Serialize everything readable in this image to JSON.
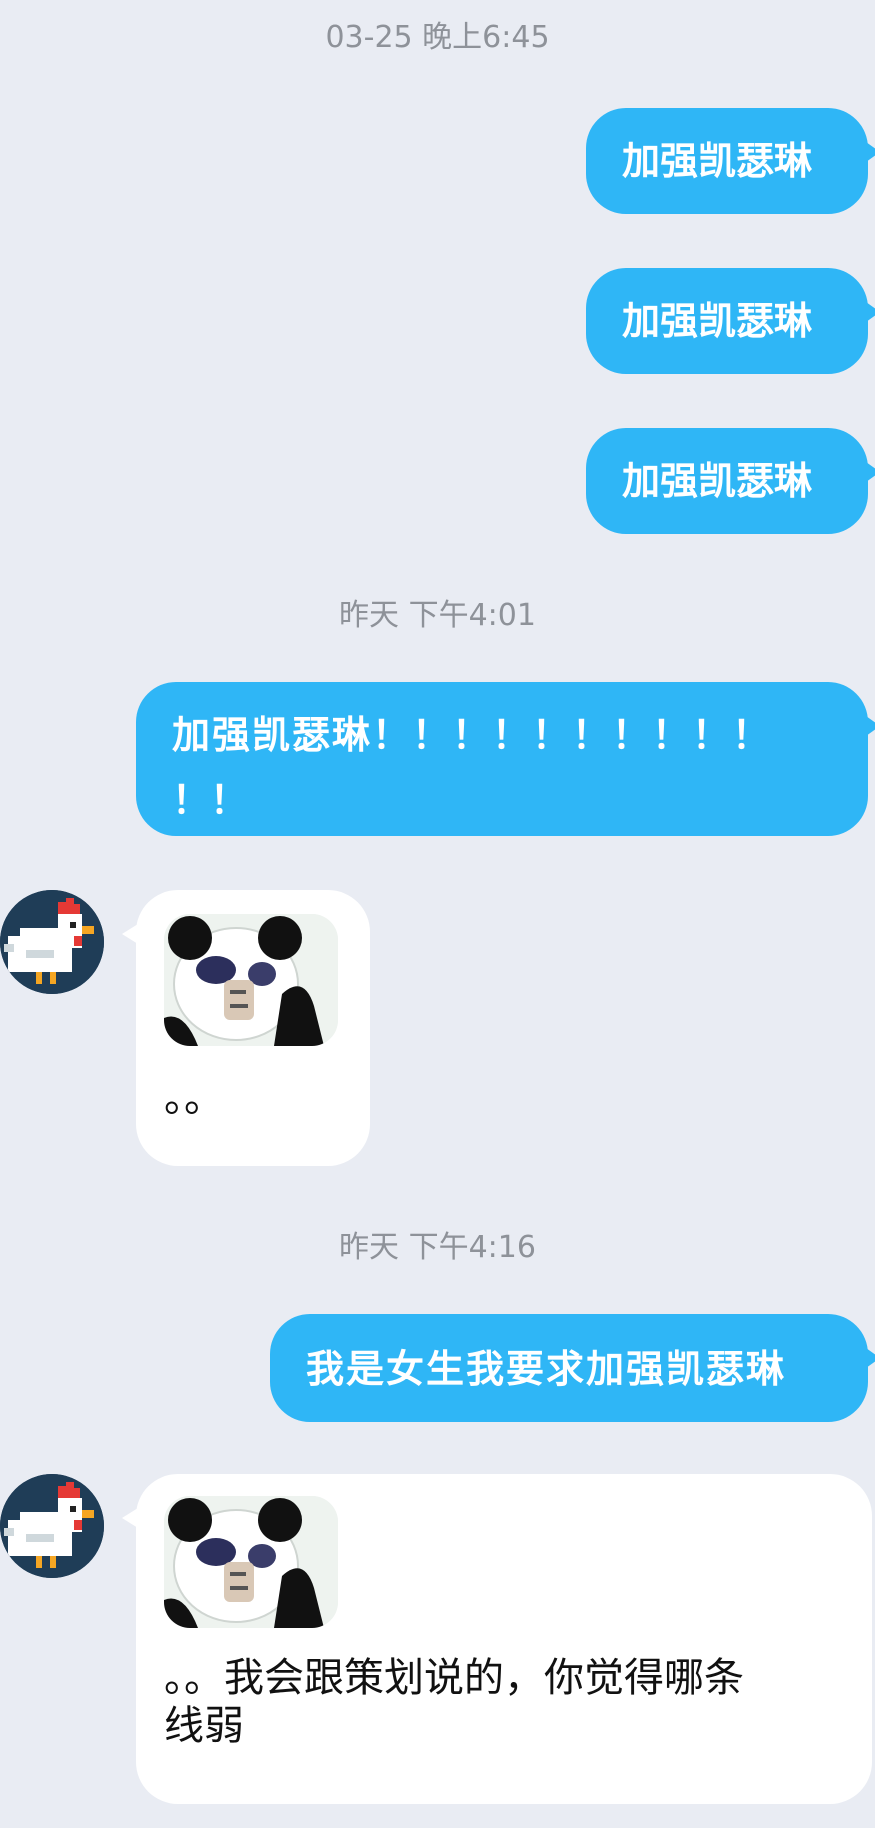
{
  "messages": {
    "ts1": "03-25 晚上6:45",
    "m1": "加强凯瑟琳",
    "m2": "加强凯瑟琳",
    "m3": "加强凯瑟琳",
    "ts2": "昨天 下午4:01",
    "m4_line1": "加强凯瑟琳！！！！！！！！！！",
    "m4_line2": "！！",
    "r1": "。。",
    "ts3": "昨天 下午4:16",
    "m5": "我是女生我要求加强凯瑟琳",
    "r2_line1": "。。我会跟策划说的，你觉得哪条",
    "r2_line2": "线弱"
  },
  "colors": {
    "background": "#e9ecf3",
    "outgoing_bubble": "#2fb6f6",
    "incoming_bubble": "#ffffff",
    "timestamp": "#8e9299"
  },
  "icons": {
    "avatar": "pixel-chicken-avatar",
    "sticker": "panda-meme-sticker"
  }
}
